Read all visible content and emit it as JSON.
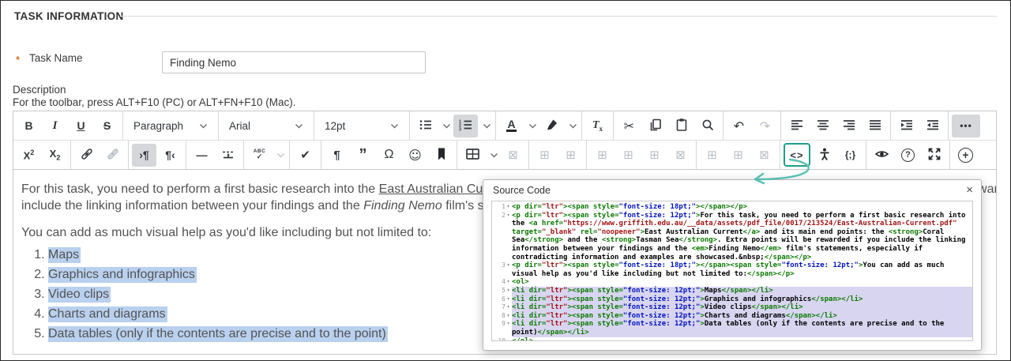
{
  "header": {
    "title": "TASK INFORMATION"
  },
  "form": {
    "required_marker": "*",
    "task_name_label": "Task Name",
    "task_name_value": "Finding Nemo",
    "description_label": "Description",
    "toolbar_hint": "For the toolbar, press ALT+F10 (PC) or ALT+FN+F10 (Mac)."
  },
  "toolbar": {
    "labels": {
      "bold": "B",
      "italic": "I",
      "underline": "U",
      "strikethrough": "S",
      "paragraph_style": "Paragraph",
      "font_family": "Arial",
      "font_size": "12pt",
      "forecolor": "A",
      "clear_t": "T",
      "clear_x": "x",
      "cut": "✂",
      "undo": "↶",
      "redo": "↷",
      "more": "•••",
      "sup_base": "X",
      "sup_exp": "2",
      "sub_base": "X",
      "sub_idx": "2",
      "ltr": "›¶",
      "rtl": "¶‹",
      "hr": "—",
      "spell_abc": "ABC",
      "spell_tick": "✓",
      "tick": "✔",
      "pilcrow": "¶",
      "quote": "”",
      "omega": "Ω",
      "smiley": "☺",
      "grid": "⊞",
      "grid_delete": "⊠",
      "source_code": "<>",
      "code_sample": "{;}",
      "help": "?",
      "add": "+"
    }
  },
  "editor": {
    "paragraph1_lines": [
      [
        {
          "text": "For this task, you need to perform a first basic research into the "
        },
        {
          "text": "East Australian Current",
          "style": "link"
        },
        {
          "text": " and its main end points: the "
        },
        {
          "text": "Coral Sea",
          "style": "bold"
        },
        {
          "text": " and the "
        },
        {
          "text": "Tasman Sea",
          "style": "bold"
        },
        {
          "text": ". Extra points will be rewarded if you"
        }
      ],
      [
        {
          "text": "include the linking information between your findings and the "
        },
        {
          "text": "Finding Nemo",
          "style": "italic"
        },
        {
          "text": " film's statements, especially if contradicting information and examples are showcased."
        }
      ]
    ],
    "paragraph2": "You can add as much visual help as you'd like including but not limited to:",
    "list_items": [
      "Maps",
      "Graphics and infographics",
      "Video clips",
      "Charts and diagrams",
      "Data tables (only if the contents are precise and to the point)"
    ]
  },
  "source_dialog": {
    "title": "Source Code",
    "close_label": "×",
    "selection_start_line": 5,
    "selection_end_line": 9,
    "lines": [
      "<p dir=\"ltr\"><span style=\"font-size: 18pt;\"></span></p>",
      "<p dir=\"ltr\"><span style=\"font-size: 12pt;\">For this task, you need to perform a first basic research into the <a href=\"https://www.griffith.edu.au/__data/assets/pdf_file/0017/213524/East-Australian-Current.pdf\" target=\"_blank\" rel=\"noopener\">East Australian Current</a> and its main end points: the <strong>Coral Sea</strong> and the <strong>Tasman Sea</strong>. Extra points will be rewarded if you include the linking information between your findings and the <em>Finding Nemo</em> film's statements, especially if contradicting information and examples are showcased.&nbsp;</span></p>",
      "<p dir=\"ltr\"><span style=\"font-size: 18pt;\"></span><span style=\"font-size: 12pt;\">You can add as much visual help as you'd like including but not limited to:</span></p>",
      "<ol>",
      "<li dir=\"ltr\"><span style=\"font-size: 12pt;\">Maps</span></li>",
      "<li dir=\"ltr\"><span style=\"font-size: 12pt;\">Graphics and infographics</span></li>",
      "<li dir=\"ltr\"><span style=\"font-size: 12pt;\">Video clips</span></li>",
      "<li dir=\"ltr\"><span style=\"font-size: 12pt;\">Charts and diagrams</span></li>",
      "<li dir=\"ltr\"><span style=\"font-size: 12pt;\">Data tables (only if the contents are precise and to the point)</span></li>",
      "</ol>"
    ]
  },
  "colors": {
    "accent_teal": "#1e9e8e",
    "selection_blue": "#b9d0ee",
    "code_selection": "#d8d5f0",
    "required_orange": "#e0772e"
  }
}
